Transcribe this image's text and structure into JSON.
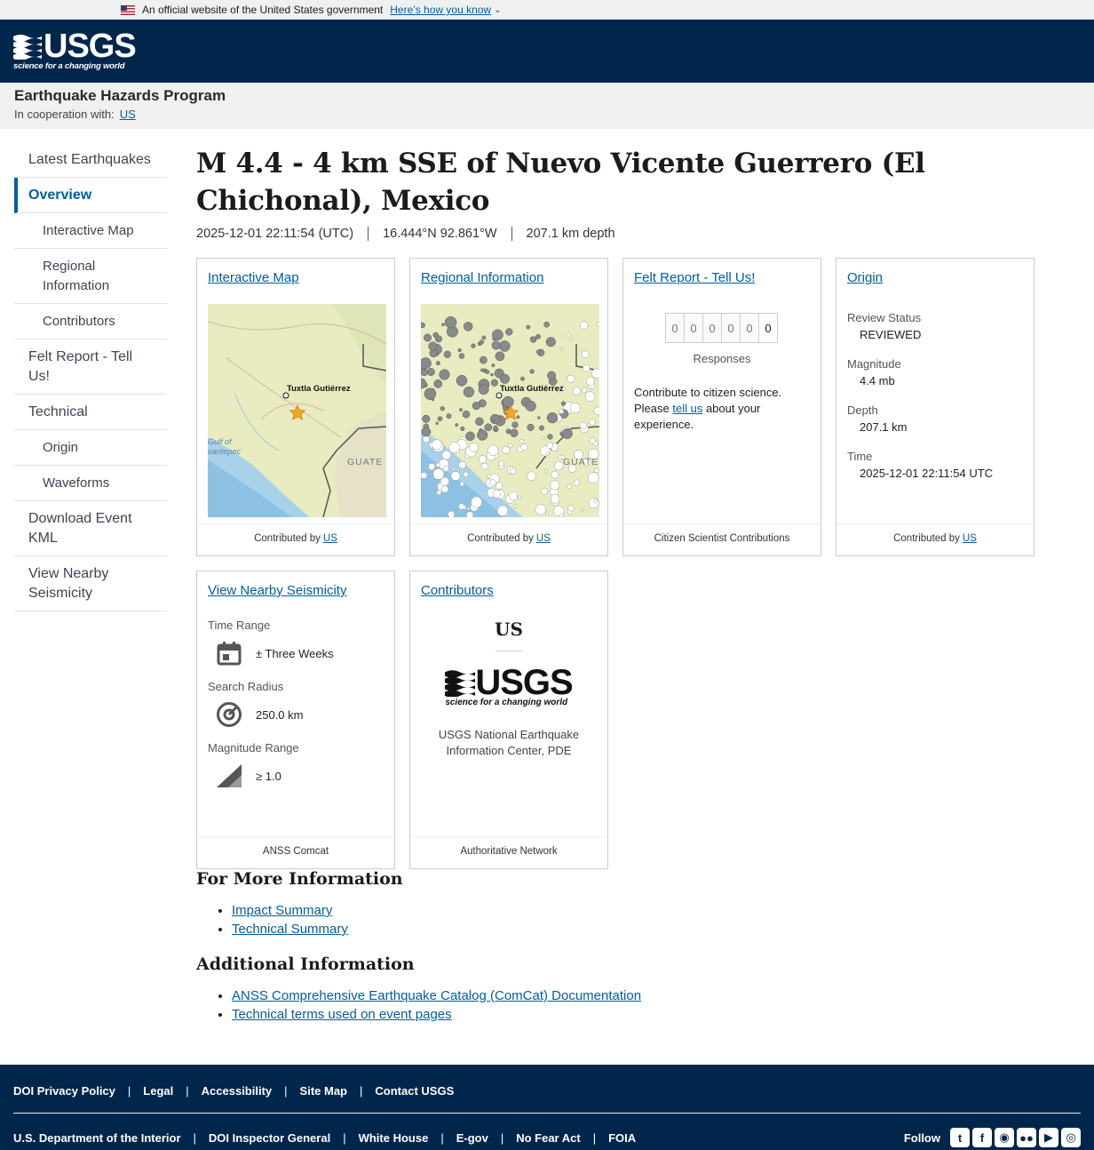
{
  "banner": {
    "text": "An official website of the United States government",
    "link": "Here’s how you know"
  },
  "header": {
    "logo_text": "USGS",
    "logo_tagline": "science for a changing world"
  },
  "program": {
    "title": "Earthquake Hazards Program",
    "coop_label": "In cooperation with:",
    "coop_link": "US"
  },
  "sidebar": {
    "items": [
      {
        "label": "Latest Earthquakes"
      },
      {
        "label": "Overview"
      },
      {
        "label": "Interactive Map"
      },
      {
        "label": "Regional Information"
      },
      {
        "label": "Contributors"
      },
      {
        "label": "Felt Report - Tell Us!"
      },
      {
        "label": "Technical"
      },
      {
        "label": "Origin"
      },
      {
        "label": "Waveforms"
      },
      {
        "label": "Download Event KML"
      },
      {
        "label": "View Nearby Seismicity"
      }
    ]
  },
  "event": {
    "title": "M 4.4 - 4 km SSE of Nuevo Vicente Guerrero (El Chichonal), Mexico",
    "time": "2025-12-01 22:11:54 (UTC)",
    "location": "16.444°N 92.861°W",
    "depth": "207.1 km depth"
  },
  "cards": {
    "interactive_map": {
      "title": "Interactive Map",
      "city_label": "Tuxtla Gutiérrez",
      "gulf_label_1": "Gulf of",
      "gulf_label_2": "uantepec",
      "country_label": "GUATE",
      "foot_prefix": "Contributed by",
      "foot_link": "US"
    },
    "regional": {
      "title": "Regional Information",
      "city_label": "Tuxtla Gutiérrez",
      "country_label": "GUATE",
      "foot_prefix": "Contributed by",
      "foot_link": "US"
    },
    "felt": {
      "title": "Felt Report - Tell Us!",
      "digits": [
        "0",
        "0",
        "0",
        "0",
        "0",
        "0"
      ],
      "responses_label": "Responses",
      "text_before": "Contribute to citizen science. Please ",
      "text_link": "tell us",
      "text_after": " about your experience.",
      "foot": "Citizen Scientist Contributions"
    },
    "origin": {
      "title": "Origin",
      "review_label": "Review Status",
      "review_value": "REVIEWED",
      "magnitude_label": "Magnitude",
      "magnitude_value": "4.4 mb",
      "depth_label": "Depth",
      "depth_value": "207.1 km",
      "time_label": "Time",
      "time_value": "2025-12-01 22:11:54 UTC",
      "foot_prefix": "Contributed by",
      "foot_link": "US"
    },
    "nearby": {
      "title": "View Nearby Seismicity",
      "time_label": "Time Range",
      "time_value": "± Three Weeks",
      "radius_label": "Search Radius",
      "radius_value": "250.0 km",
      "mag_label": "Magnitude Range",
      "mag_value": "≥ 1.0",
      "foot": "ANSS Comcat"
    },
    "contributors": {
      "title": "Contributors",
      "network": "US",
      "logo_text": "USGS",
      "logo_tagline": "science for a changing world",
      "name": "USGS National Earthquake Information Center, PDE",
      "foot": "Authoritative Network"
    }
  },
  "more_info": {
    "heading": "For More Information",
    "links": [
      "Impact Summary",
      "Technical Summary"
    ]
  },
  "additional_info": {
    "heading": "Additional Information",
    "links": [
      "ANSS Comprehensive Earthquake Catalog (ComCat) Documentation",
      "Technical terms used on event pages"
    ]
  },
  "footer": {
    "row1": [
      "DOI Privacy Policy",
      "Legal",
      "Accessibility",
      "Site Map",
      "Contact USGS"
    ],
    "row2": [
      "U.S. Department of the Interior",
      "DOI Inspector General",
      "White House",
      "E-gov",
      "No Fear Act",
      "FOIA"
    ],
    "follow_label": "Follow"
  },
  "colors": {
    "header_bg": "#00264c",
    "link": "#005ea2",
    "epicenter": "#f5a623"
  }
}
